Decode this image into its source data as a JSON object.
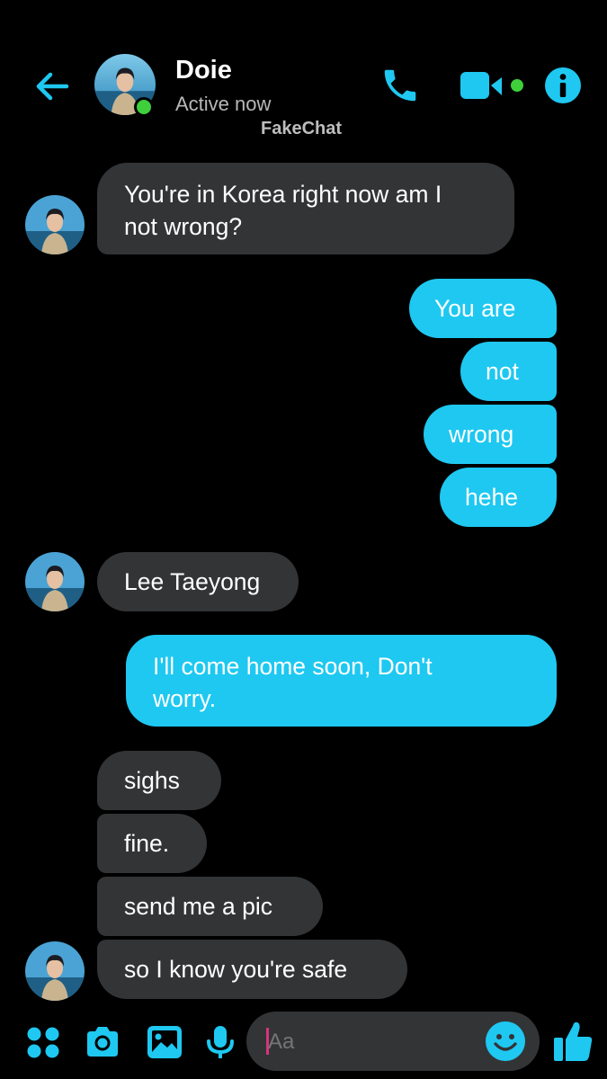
{
  "header": {
    "contact_name": "Doie",
    "status": "Active now",
    "watermark": "FakeChat",
    "icons": [
      "back-arrow-icon",
      "phone-icon",
      "video-camera-icon",
      "info-icon"
    ]
  },
  "messages": [
    {
      "side": "in",
      "text_lines": [
        "You're in Korea right now am I",
        "not wrong?"
      ],
      "avatar": true
    },
    {
      "side": "out",
      "text": "You are"
    },
    {
      "side": "out",
      "text": "not"
    },
    {
      "side": "out",
      "text": "wrong"
    },
    {
      "side": "out",
      "text": "hehe"
    },
    {
      "side": "in",
      "text": "Lee Taeyong",
      "avatar": true
    },
    {
      "side": "out",
      "text_lines": [
        "I'll come home soon, Don't",
        "worry."
      ]
    },
    {
      "side": "in",
      "text": "sighs"
    },
    {
      "side": "in",
      "text": "fine."
    },
    {
      "side": "in",
      "text": "send me a pic"
    },
    {
      "side": "in",
      "text": "so I know you're safe",
      "avatar": true
    }
  ],
  "composer": {
    "placeholder": "Aa",
    "icons": [
      "apps-grid-icon",
      "camera-icon",
      "image-icon",
      "microphone-icon",
      "emoji-icon",
      "thumbs-up-icon"
    ]
  },
  "colors": {
    "accent": "#1ec8f1",
    "incoming_bubble": "#333436",
    "background": "#000000",
    "online": "#3ecf3b"
  }
}
